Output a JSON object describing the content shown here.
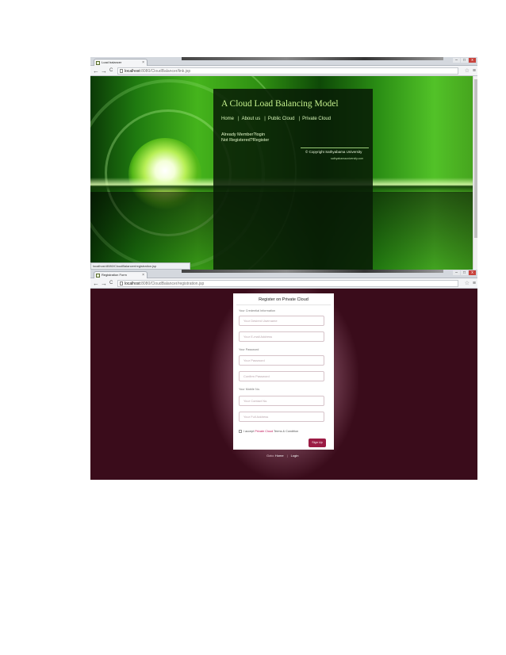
{
  "window1": {
    "tab_title": "Load balancer",
    "tab_close": "×",
    "nav_back": "←",
    "nav_forward": "→",
    "nav_reload": "C",
    "url_host": "localhost",
    "url_path": ":8080/CloudBalancer/link.jsp",
    "star": "☆",
    "menu": "≡",
    "win_min": "–",
    "win_max": "□",
    "win_close": "x",
    "site": {
      "title": "A Cloud Load Balancing Model",
      "nav": [
        "Home",
        "About us",
        "Public Cloud",
        "Private Cloud"
      ],
      "nav_sep": "|",
      "member_link": "Already Member?login",
      "register_link": "Not Registered?Register",
      "copyright": "© Copyright Sathyabama University",
      "site_url": "sathyabamauniversity.com"
    },
    "status_url": "localhost:8080/CloudBalancer/registration.jsp"
  },
  "window2": {
    "tab_title": "Registration Form",
    "tab_close": "×",
    "nav_back": "←",
    "nav_forward": "→",
    "nav_reload": "C",
    "url_host": "localhost",
    "url_path": ":8080/CloudBalancer/registration.jsp",
    "star": "☆",
    "menu": "≡",
    "win_min": "–",
    "win_max": "□",
    "win_close": "x",
    "form": {
      "title": "Register on Private Cloud",
      "section_credentials": "Your Credential Information",
      "username_placeholder": "Your Desired Username",
      "email_placeholder": "Your E-mail Address",
      "section_password": "Your Password",
      "password_placeholder": "Your Password",
      "confirm_placeholder": "Confirm Password",
      "section_mobile": "Your Mobile No.",
      "mobile_placeholder": "Your Contact No.",
      "address_placeholder": "Your Full Address",
      "terms_prefix": "I accept",
      "terms_link": "Private Cloud",
      "terms_suffix": "Terms & Condition",
      "signup_label": "Sign Up"
    },
    "footer": {
      "goto_label": "Goto:",
      "home_link": "Home",
      "sep": "|",
      "login_link": "Login"
    }
  },
  "colors": {
    "form_accent": "#9b1b44",
    "page2_bg": "#3a0c1b",
    "title_green": "#c4f08d"
  }
}
